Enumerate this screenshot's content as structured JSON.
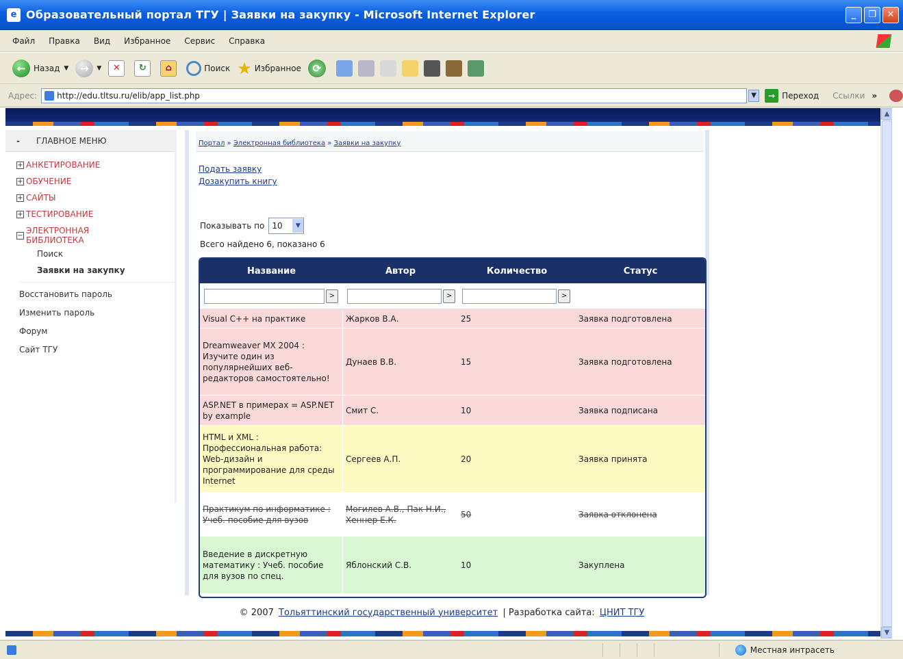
{
  "window": {
    "title": "Образовательный портал ТГУ | Заявки на закупку - Microsoft Internet Explorer"
  },
  "menubar": [
    "Файл",
    "Правка",
    "Вид",
    "Избранное",
    "Сервис",
    "Справка"
  ],
  "toolbar": {
    "back": "Назад",
    "search": "Поиск",
    "favorites": "Избранное"
  },
  "address": {
    "label": "Адрес:",
    "url": "http://edu.tltsu.ru/elib/app_list.php",
    "go": "Переход",
    "links": "Ссылки"
  },
  "sidebar": {
    "heading": "ГЛАВНОЕ МЕНЮ",
    "items": [
      {
        "label": "АНКЕТИРОВАНИЕ"
      },
      {
        "label": "ОБУЧЕНИЕ"
      },
      {
        "label": "САЙТЫ"
      },
      {
        "label": "ТЕСТИРОВАНИЕ"
      },
      {
        "label": "ЭЛЕКТРОННАЯ БИБЛИОТЕКА"
      }
    ],
    "subitems": [
      "Поиск",
      "Заявки на закупку"
    ],
    "links": [
      "Восстановить пароль",
      "Изменить пароль",
      "Форум",
      "Сайт ТГУ"
    ]
  },
  "breadcrumb": [
    "Портал",
    "Электронная библиотека",
    "Заявки на закупку"
  ],
  "actions": {
    "submit": "Подать заявку",
    "order": "Дозакупить книгу"
  },
  "pager": {
    "label": "Показывать по",
    "value": "10"
  },
  "total": "Всего найдено 6, показано 6",
  "table": {
    "headers": [
      "Название",
      "Автор",
      "Количество",
      "Статус"
    ],
    "rows": [
      {
        "title": "Visual C++ на практике",
        "author": "Жарков В.А.",
        "qty": "25",
        "status": "Заявка подготовлена"
      },
      {
        "title": "Dreamweaver MX 2004 : Изучите один из популярнейших веб-редакторов самостоятельно!",
        "author": "Дунаев В.В.",
        "qty": "15",
        "status": "Заявка подготовлена"
      },
      {
        "title": "ASP.NET в примерах = ASP.NET by example",
        "author": "Смит С.",
        "qty": "10",
        "status": "Заявка подписана"
      },
      {
        "title": "HTML и XML : Профессиональная работа: Web-дизайн и программирование для среды Internet",
        "author": "Сергеев А.П.",
        "qty": "20",
        "status": "Заявка принята"
      },
      {
        "title": "Практикум по информатике : Учеб. пособие для вузов",
        "author": "Могилев А.В., Пак Н.И., Хеннер Е.К.",
        "qty": "50",
        "status": "Заявка отклонена"
      },
      {
        "title": "Введение в дискретную математику : Учеб. пособие для вузов по спец.",
        "author": "Яблонский С.В.",
        "qty": "10",
        "status": "Закуплена"
      }
    ]
  },
  "footer": {
    "copyright": "© 2007",
    "university": "Тольяттинский государственный университет",
    "sep": "| Разработка сайта:",
    "dev": "ЦНИТ ТГУ"
  },
  "status": {
    "zone": "Местная интрасеть"
  }
}
